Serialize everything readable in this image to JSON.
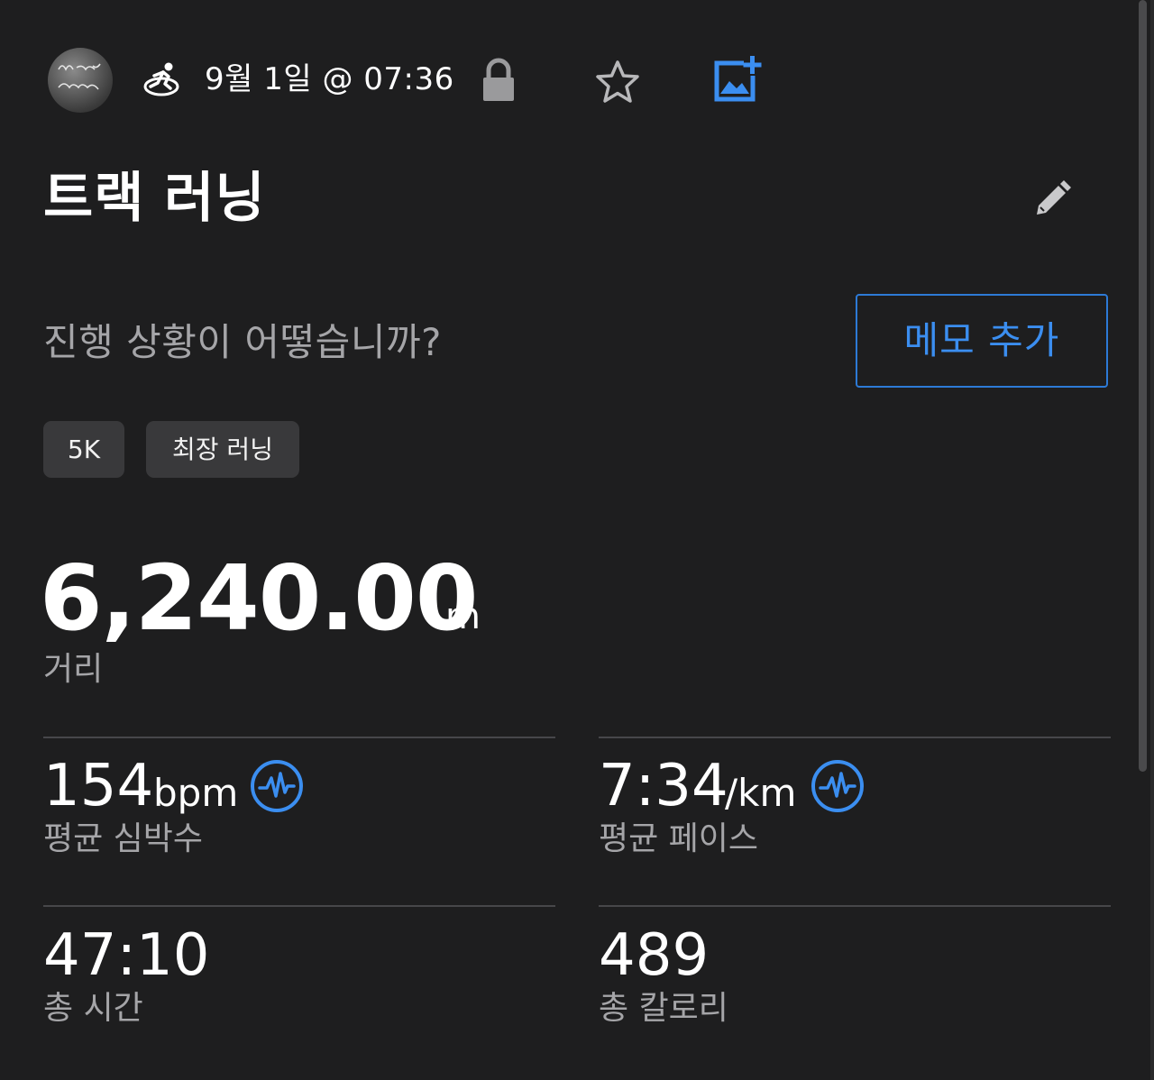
{
  "header": {
    "avatar_icon": "profile-avatar",
    "activity_icon": "running-activity-icon",
    "date_time": "9월 1일 @ 07:36",
    "lock_icon": "lock-icon",
    "favorite_icon": "star-icon",
    "add_photo_icon": "add-photo-icon"
  },
  "activity": {
    "title": "트랙 러닝",
    "edit_icon": "pencil-icon",
    "prompt": "진행 상황이 어떻습니까?",
    "add_memo_label": "메모 추가",
    "tags": [
      "5K",
      "최장 러닝"
    ]
  },
  "distance": {
    "value": "6,240.00",
    "unit": "m",
    "label": "거리"
  },
  "stats": {
    "avg_heart_rate": {
      "value": "154",
      "unit": "bpm",
      "label": "평균 심박수",
      "icon": "heart-rate-chart-icon"
    },
    "avg_pace": {
      "value": "7:34",
      "unit": "/km",
      "label": "평균 페이스",
      "icon": "pace-chart-icon"
    },
    "total_time": {
      "value": "47:10",
      "label": "총 시간"
    },
    "total_calories": {
      "value": "489",
      "label": "총 칼로리"
    }
  },
  "colors": {
    "background": "#1e1e1f",
    "accent_blue": "#3b8ef0",
    "secondary_text": "#a5a5a8",
    "tag_background": "#39393b"
  }
}
